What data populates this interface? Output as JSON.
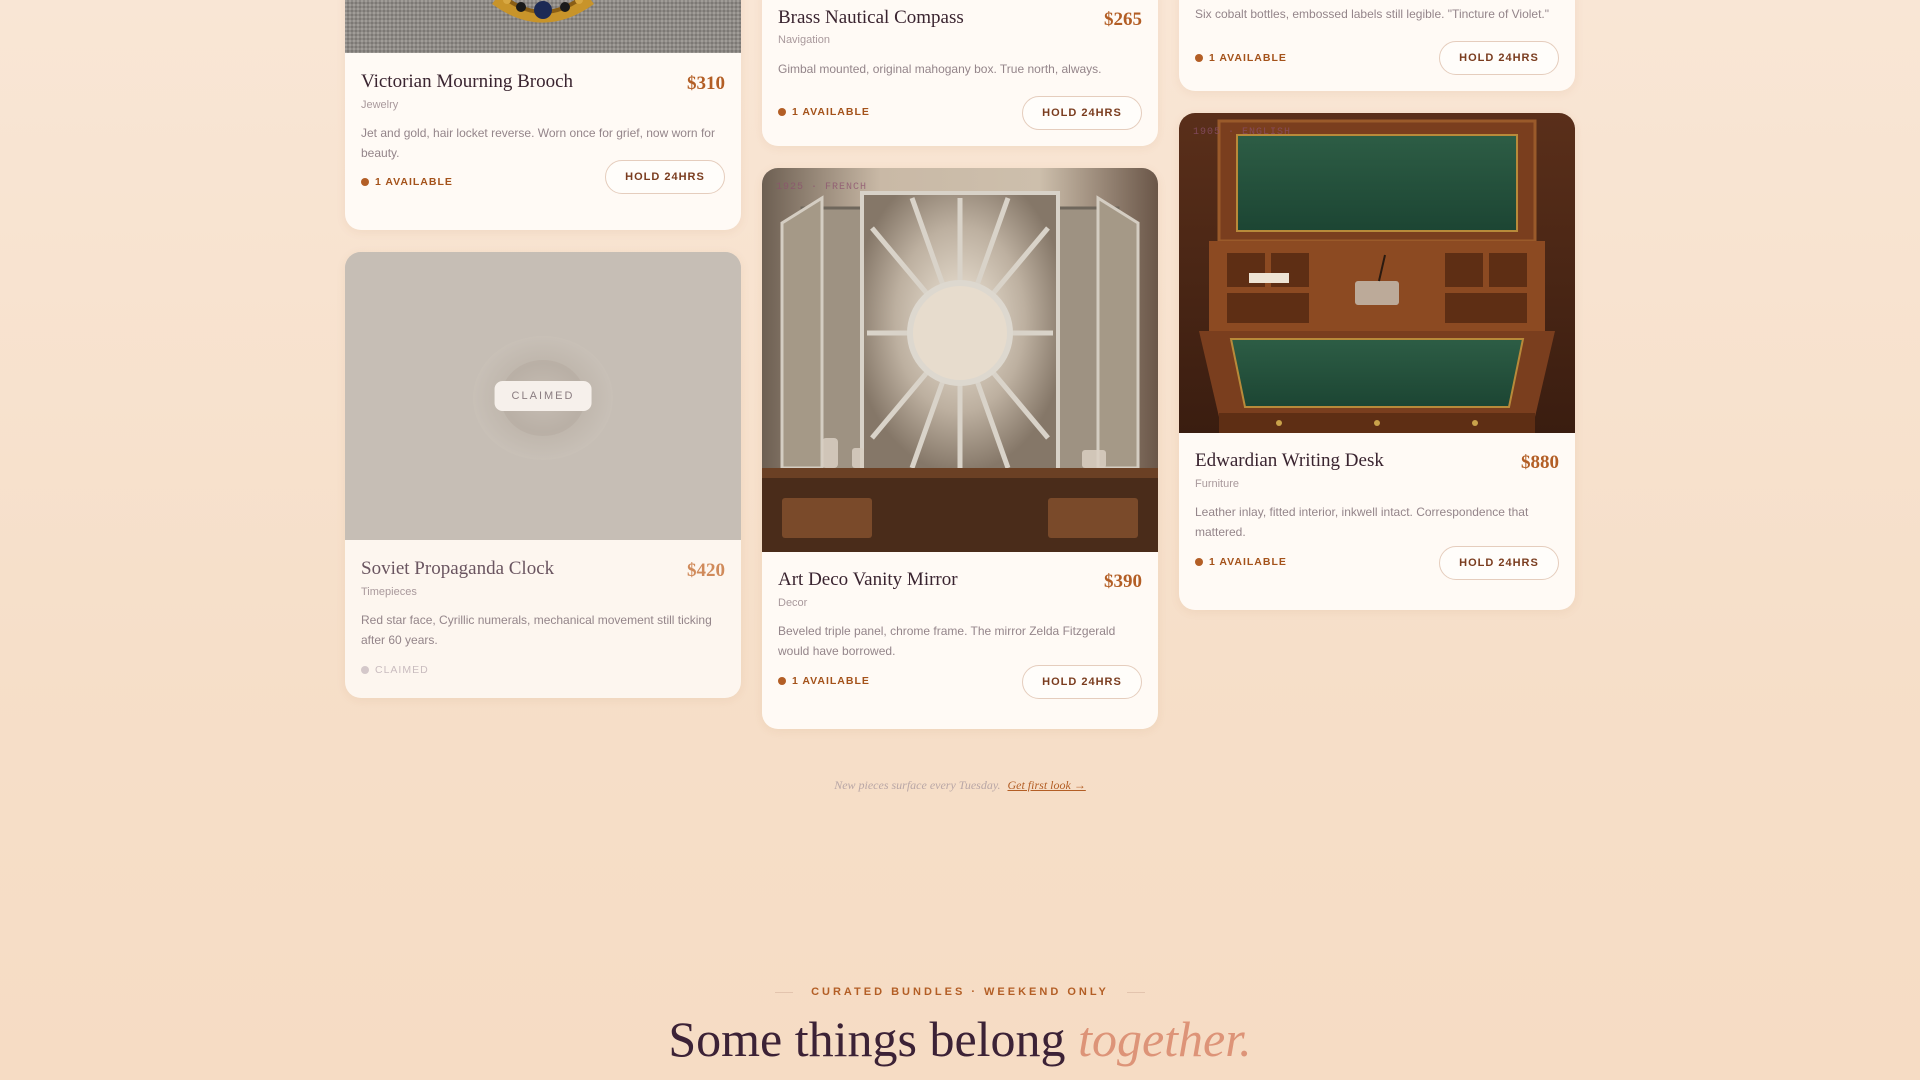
{
  "products": [
    {
      "title": "Victorian Mourning Brooch",
      "price": "$310",
      "category": "Jewelry",
      "desc": "Jet and gold, hair locket reverse. Worn once for grief, now worn for beauty.",
      "status": "1 AVAILABLE",
      "action": "HOLD 24HRS"
    },
    {
      "title": "Soviet Propaganda Clock",
      "price": "$420",
      "category": "Timepieces",
      "desc": "Red star face, Cyrillic numerals, mechanical movement still ticking after 60 years.",
      "status": "CLAIMED",
      "badge": "CLAIMED"
    },
    {
      "title": "Brass Nautical Compass",
      "price": "$265",
      "category": "Navigation",
      "desc": "Gimbal mounted, original mahogany box. True north, always.",
      "status": "1 AVAILABLE",
      "action": "HOLD 24HRS"
    },
    {
      "title": "Art Deco Vanity Mirror",
      "price": "$390",
      "category": "Decor",
      "era": "1925 · FRENCH",
      "desc": "Beveled triple panel, chrome frame. The mirror Zelda Fitzgerald would have borrowed.",
      "status": "1 AVAILABLE",
      "action": "HOLD 24HRS"
    },
    {
      "desc": "Six cobalt bottles, embossed labels still legible. \"Tincture of Violet.\"",
      "status": "1 AVAILABLE",
      "action": "HOLD 24HRS"
    },
    {
      "title": "Edwardian Writing Desk",
      "price": "$880",
      "category": "Furniture",
      "era": "1905 · ENGLISH",
      "desc": "Leather inlay, fitted interior, inkwell intact. Correspondence that mattered.",
      "status": "1 AVAILABLE",
      "action": "HOLD 24HRS"
    }
  ],
  "footer": {
    "note": "New pieces surface every Tuesday.",
    "link": "Get first look →"
  },
  "bundles": {
    "eyebrow": "CURATED BUNDLES · WEEKEND ONLY",
    "headline_main": "Some things belong",
    "headline_accent": "together."
  },
  "colors": {
    "accent": "#b35e25",
    "heading": "#3c2236",
    "background": "#f9e6d5"
  }
}
